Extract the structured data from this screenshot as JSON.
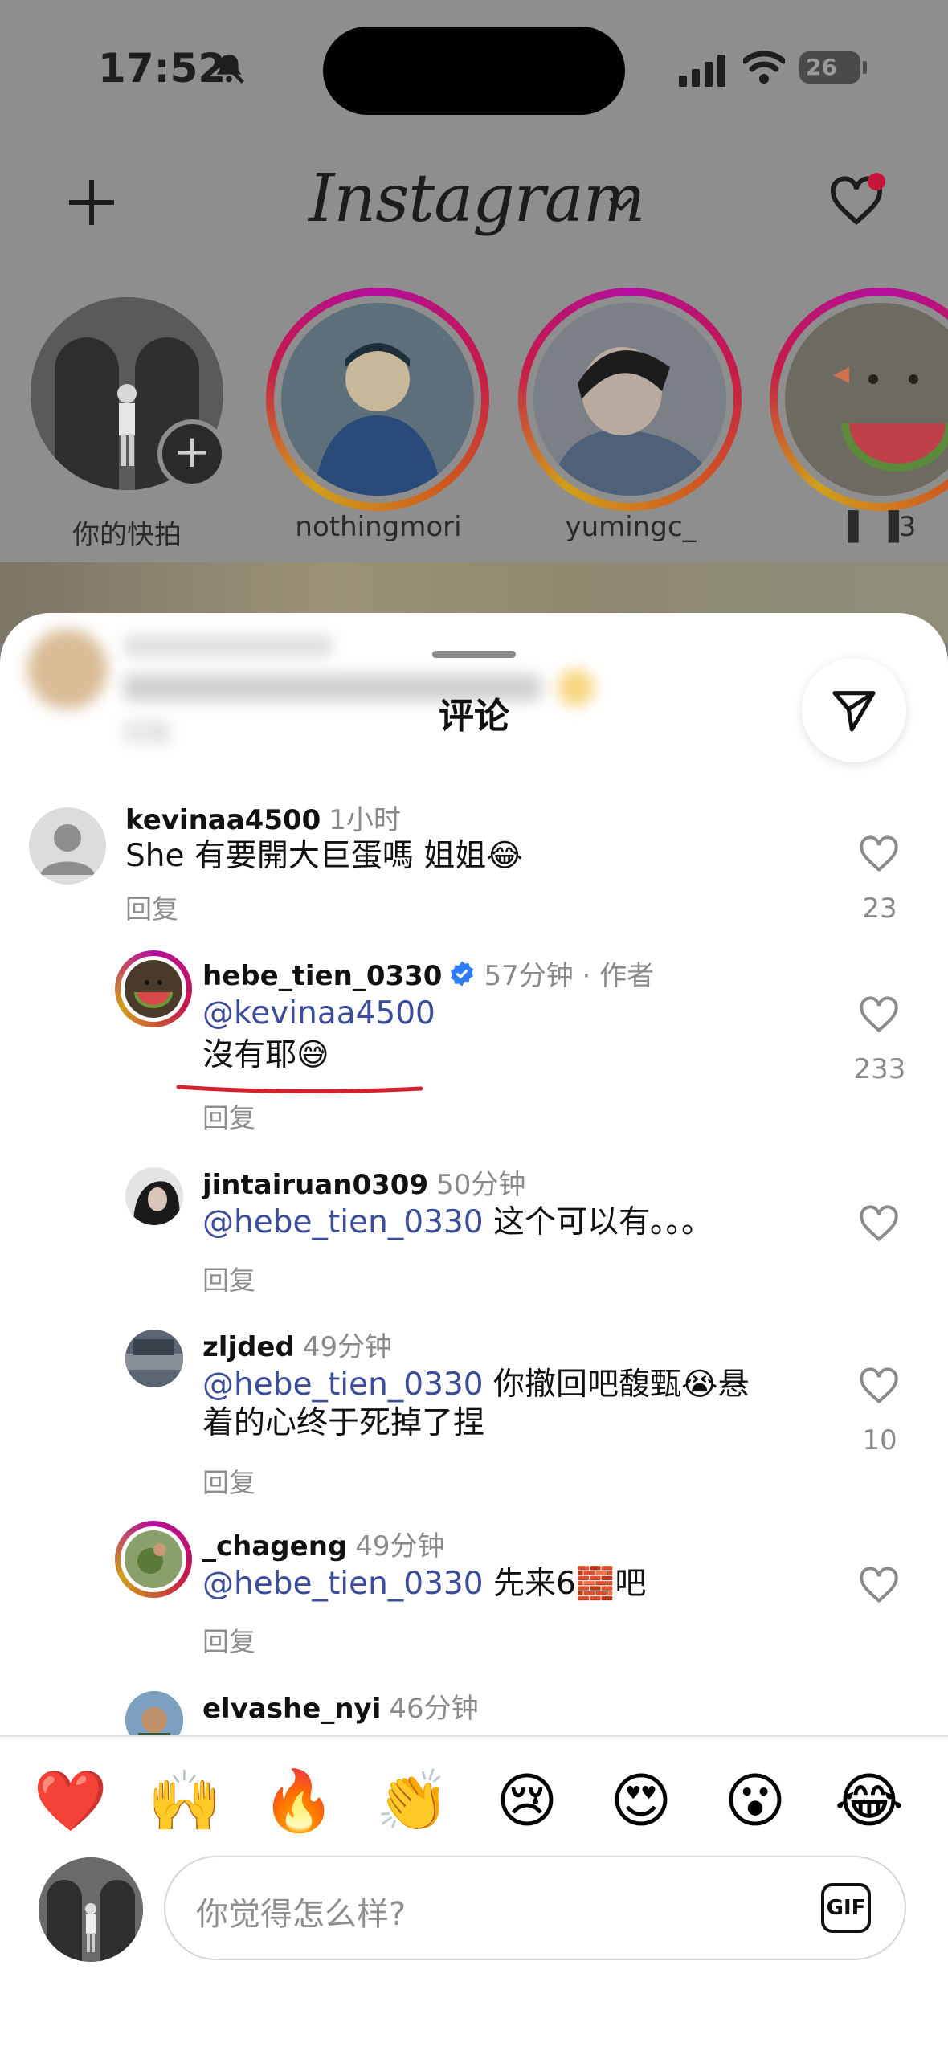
{
  "status_bar": {
    "time": "17:52",
    "battery": "26"
  },
  "header": {
    "logo": "Instagram"
  },
  "stories": [
    {
      "name": "你的快拍"
    },
    {
      "name": "nothingmori"
    },
    {
      "name": "yumingc_"
    },
    {
      "name": "▌ ▐3"
    }
  ],
  "sheet": {
    "title": "评论",
    "blurred_reply": "回复",
    "comments": [
      {
        "user": "kevinaa4500",
        "time": "1小时",
        "text": "She 有要開大巨蛋嗎 姐姐😂",
        "reply": "回复",
        "likes": "23"
      },
      {
        "user": "hebe_tien_0330",
        "time": "57分钟 · 作者",
        "mention": "@kevinaa4500",
        "text": "沒有耶😅",
        "reply": "回复",
        "likes": "233"
      },
      {
        "user": "jintairuan0309",
        "time": "50分钟",
        "mention": "@hebe_tien_0330",
        "text": " 这个可以有。。。",
        "reply": "回复",
        "likes": ""
      },
      {
        "user": "zljded",
        "time": "49分钟",
        "mention": "@hebe_tien_0330",
        "text": " 你撤回吧馥甄😭悬",
        "text2": "着的心终于死掉了捏",
        "reply": "回复",
        "likes": "10"
      },
      {
        "user": "_chageng",
        "time": "49分钟",
        "mention": "@hebe_tien_0330",
        "text": " 先来6🧱吧",
        "reply": "回复",
        "likes": ""
      },
      {
        "user": "elvashe_nyi",
        "time": "46分钟"
      }
    ]
  },
  "reactions": [
    "❤️",
    "🙌",
    "🔥",
    "👏",
    "😢",
    "😍",
    "😮",
    "😂"
  ],
  "composer": {
    "placeholder": "你觉得怎么样?",
    "gif_label": "GIF"
  },
  "colors": {
    "mention": "#3b4c9a",
    "story_ring": "#c41a4a",
    "underline": "#d2222d"
  }
}
